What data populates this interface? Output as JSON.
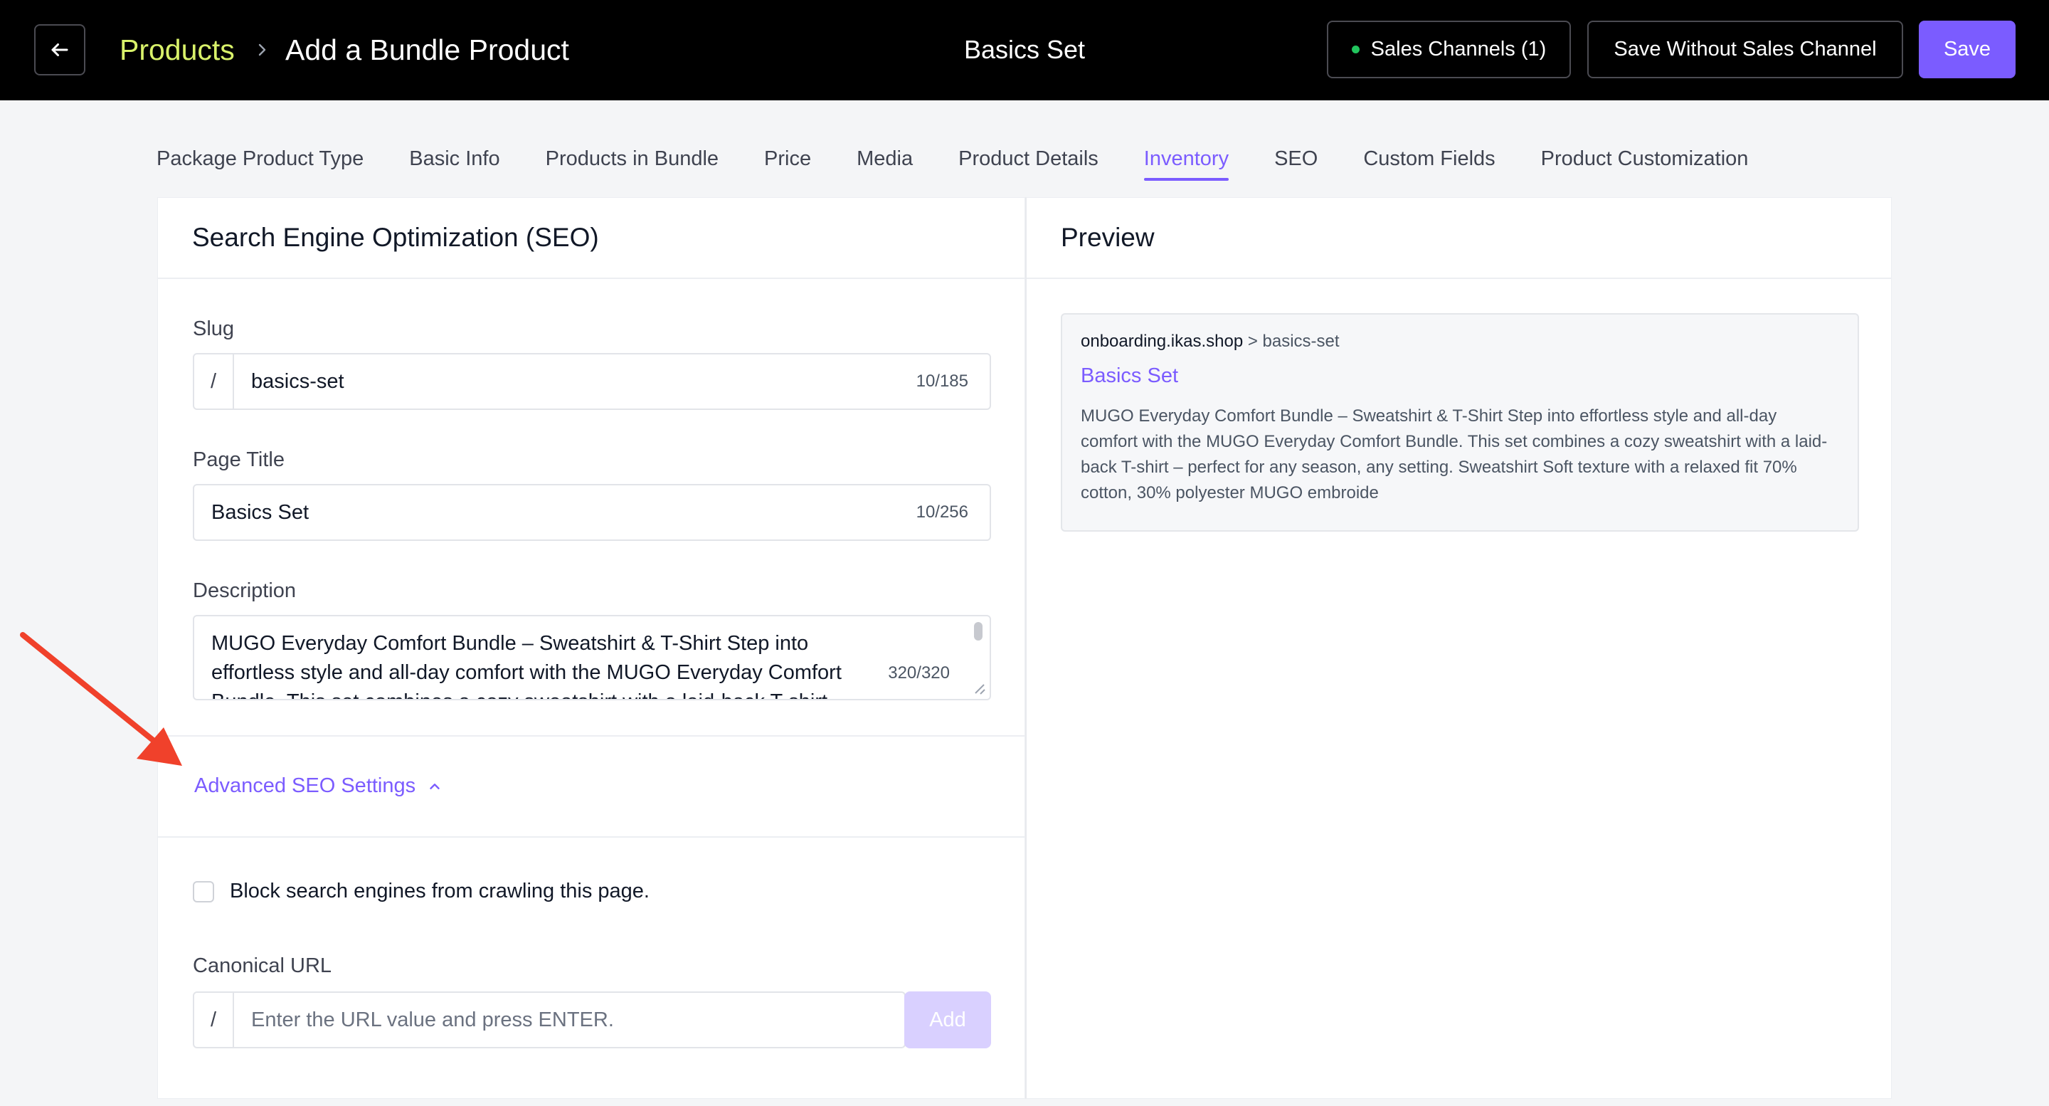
{
  "header": {
    "breadcrumb_link": "Products",
    "breadcrumb_current": "Add a Bundle Product",
    "product_title": "Basics Set",
    "sales_channels_label": "Sales Channels (1)",
    "save_without_label": "Save Without Sales Channel",
    "save_label": "Save"
  },
  "tabs": [
    {
      "label": "Package Product Type",
      "active": false
    },
    {
      "label": "Basic Info",
      "active": false
    },
    {
      "label": "Products in Bundle",
      "active": false
    },
    {
      "label": "Price",
      "active": false
    },
    {
      "label": "Media",
      "active": false
    },
    {
      "label": "Product Details",
      "active": false
    },
    {
      "label": "Inventory",
      "active": true
    },
    {
      "label": "SEO",
      "active": false
    },
    {
      "label": "Custom Fields",
      "active": false
    },
    {
      "label": "Product Customization",
      "active": false
    }
  ],
  "seo": {
    "section_title": "Search Engine Optimization (SEO)",
    "slug": {
      "label": "Slug",
      "prefix": "/",
      "value": "basics-set",
      "count": "10/185"
    },
    "page_title": {
      "label": "Page Title",
      "value": "Basics Set",
      "count": "10/256"
    },
    "description": {
      "label": "Description",
      "value": "MUGO Everyday Comfort Bundle – Sweatshirt & T-Shirt Step into effortless style and all-day comfort with the MUGO Everyday Comfort Bundle. This set combines a cozy sweatshirt with a laid-back T-shirt",
      "count": "320/320"
    },
    "advanced_label": "Advanced SEO Settings",
    "block_crawl_label": "Block search engines from crawling this page.",
    "canonical": {
      "label": "Canonical URL",
      "prefix": "/",
      "placeholder": "Enter the URL value and press ENTER.",
      "add_label": "Add"
    }
  },
  "preview": {
    "title": "Preview",
    "domain": "onboarding.ikas.shop",
    "separator": ">",
    "slug": "basics-set",
    "page_title": "Basics Set",
    "description": "MUGO Everyday Comfort Bundle – Sweatshirt & T-Shirt Step into effortless style and all-day comfort with the MUGO Everyday Comfort Bundle. This set combines a cozy sweatshirt with a laid-back T-shirt – perfect for any season, any setting. Sweatshirt Soft texture with a relaxed fit 70% cotton, 30% polyester MUGO embroide"
  },
  "colors": {
    "accent": "#7b5cff",
    "breadcrumb_link": "#d9f26a",
    "status_dot": "#22c55e",
    "annotation_arrow": "#f0412b"
  }
}
